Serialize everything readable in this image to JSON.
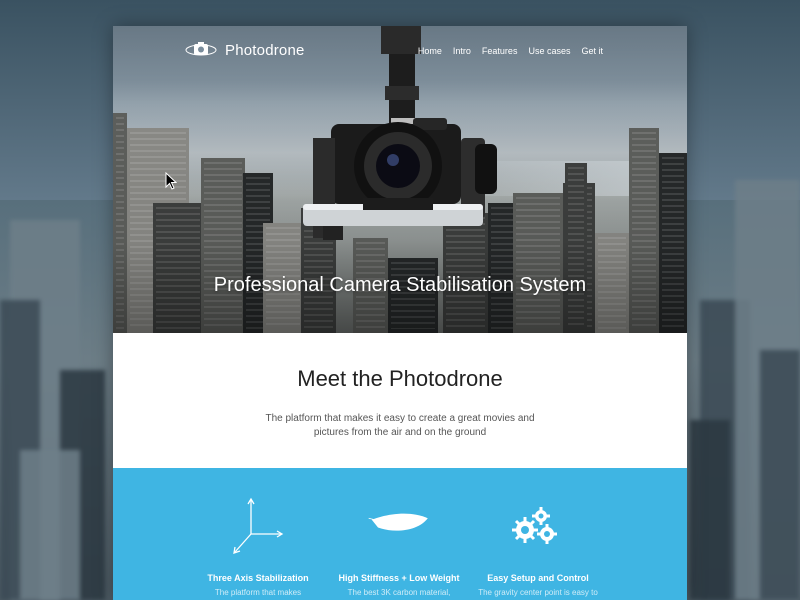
{
  "brand": {
    "name": "Photodrone"
  },
  "nav": {
    "items": [
      "Home",
      "Intro",
      "Features",
      "Use cases",
      "Get it"
    ]
  },
  "hero": {
    "title": "Professional Camera Stabilisation System"
  },
  "meet": {
    "title": "Meet the Photodrone",
    "text": "The platform that makes it easy to create a great movies and pictures from the air and on the ground"
  },
  "features": [
    {
      "icon": "axis-icon",
      "title": "Three Axis Stabilization",
      "text": "The platform that makes"
    },
    {
      "icon": "feather-icon",
      "title": "High Stiffness + Low Weight",
      "text": "The best 3K carbon material,"
    },
    {
      "icon": "gears-icon",
      "title": "Easy Setup and Control",
      "text": "The gravity center point is easy to"
    }
  ],
  "colors": {
    "accent": "#3fb5e3",
    "text_dark": "#222222",
    "text_body": "#555555"
  }
}
